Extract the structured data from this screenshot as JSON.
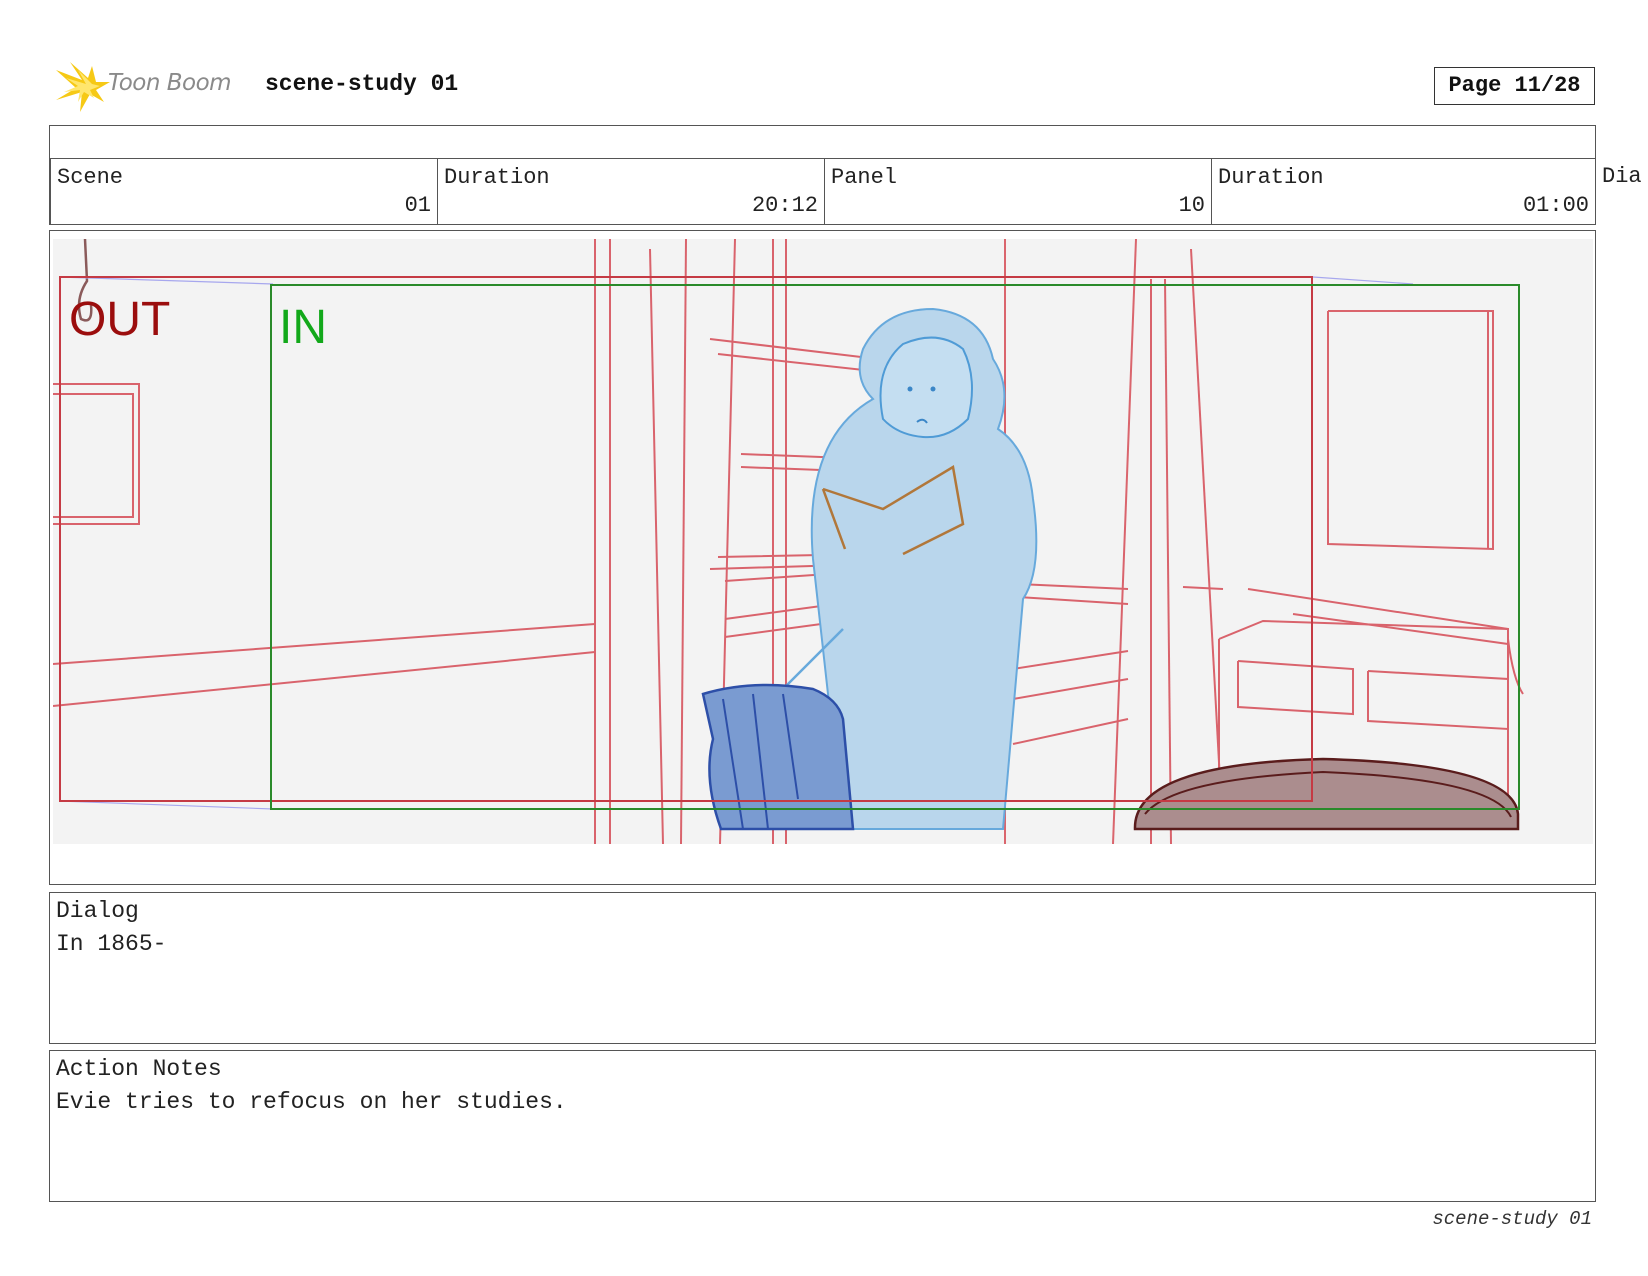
{
  "header": {
    "logo_text": "Toon Boom",
    "project_title": "scene-study 01",
    "page": "Page 11/28"
  },
  "info": {
    "scene_label": "Scene",
    "scene_value": "01",
    "scene_duration_label": "Duration",
    "scene_duration_value": "20:12",
    "panel_label": "Panel",
    "panel_value": "10",
    "panel_duration_label": "Duration",
    "panel_duration_value": "01:00",
    "overflow_label": "Dia"
  },
  "panel": {
    "out_label": "OUT",
    "in_label": "IN",
    "out_color": "#9b0d0d",
    "in_color": "#12a81a"
  },
  "dialog": {
    "label": "Dialog",
    "text": "In 1865-"
  },
  "action_notes": {
    "label": "Action Notes",
    "text": "Evie tries to refocus on her studies."
  },
  "footer": {
    "text": "scene-study 01"
  }
}
